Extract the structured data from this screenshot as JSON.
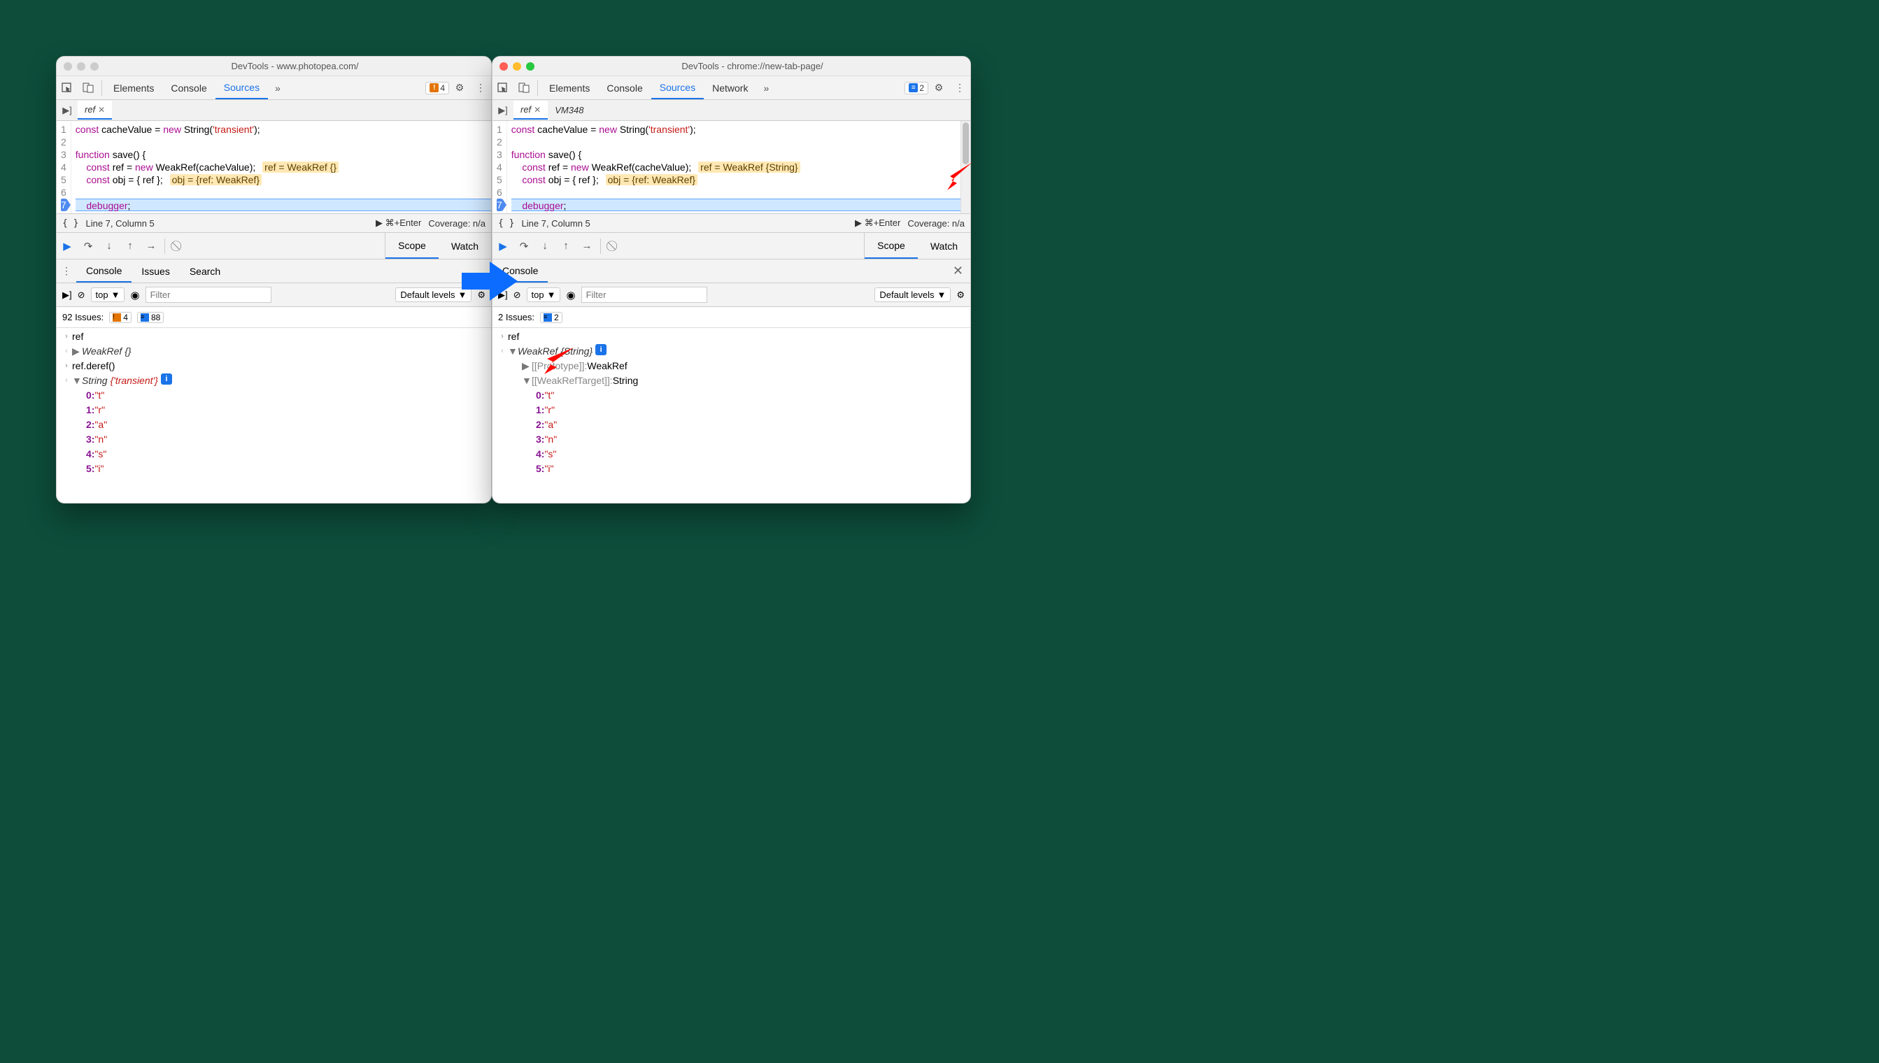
{
  "left": {
    "title": "DevTools - www.photopea.com/",
    "toolbar": {
      "tabs": [
        "Elements",
        "Console",
        "Sources"
      ],
      "active": "Sources",
      "badge_count": "4"
    },
    "file_tabs": {
      "active": "ref",
      "others": []
    },
    "code": {
      "lines": [
        {
          "n": "1",
          "pre": "const cacheValue = ",
          "kw": "new",
          "post": " String(",
          "str": "'transient'",
          "tail": ");"
        },
        {
          "n": "2",
          "pre": ""
        },
        {
          "n": "3",
          "pre": "function save() {"
        },
        {
          "n": "4",
          "pre": "    const ref = ",
          "kw": "new",
          "post": " WeakRef(cacheValue); ",
          "val": "ref = WeakRef {}"
        },
        {
          "n": "5",
          "pre": "    const obj = { ref }; ",
          "val": "obj = {ref: WeakRef}"
        },
        {
          "n": "6",
          "pre": ""
        },
        {
          "n": "7",
          "pre": "    ",
          "dbg": "debugger",
          "tail": ";",
          "exec": true
        }
      ]
    },
    "status": {
      "pos": "Line 7, Column 5",
      "run": "▶ ⌘+Enter",
      "cov": "Coverage: n/a"
    },
    "dbg_tabs": {
      "scope": "Scope",
      "watch": "Watch"
    },
    "drawer": {
      "tabs": [
        "Console",
        "Issues",
        "Search"
      ],
      "active": "Console"
    },
    "filter": {
      "context": "top",
      "levels": "Default levels",
      "placeholder": "Filter"
    },
    "issues": {
      "label": "92 Issues:",
      "warn": "4",
      "info": "88"
    },
    "console": {
      "entries": [
        {
          "t": "in",
          "text": "ref"
        },
        {
          "t": "out",
          "toggle": "▶",
          "obj": "WeakRef {}"
        },
        {
          "t": "in",
          "text": "ref.deref()"
        },
        {
          "t": "out",
          "toggle": "▼",
          "obj": "String ",
          "objstr": "{'transient'}",
          "info": true,
          "children": [
            {
              "k": "0",
              "v": "\"t\""
            },
            {
              "k": "1",
              "v": "\"r\""
            },
            {
              "k": "2",
              "v": "\"a\""
            },
            {
              "k": "3",
              "v": "\"n\""
            },
            {
              "k": "4",
              "v": "\"s\""
            },
            {
              "k": "5",
              "v": "\"i\""
            }
          ]
        }
      ]
    }
  },
  "right": {
    "title": "DevTools - chrome://new-tab-page/",
    "toolbar": {
      "tabs": [
        "Elements",
        "Console",
        "Sources",
        "Network"
      ],
      "active": "Sources",
      "badge_count": "2"
    },
    "file_tabs": {
      "active": "ref",
      "others": [
        "VM348"
      ]
    },
    "code": {
      "lines": [
        {
          "n": "1",
          "pre": "const cacheValue = ",
          "kw": "new",
          "post": " String(",
          "str": "'transient'",
          "tail": ");"
        },
        {
          "n": "2",
          "pre": ""
        },
        {
          "n": "3",
          "pre": "function save() {"
        },
        {
          "n": "4",
          "pre": "    const ref = ",
          "kw": "new",
          "post": " WeakRef(cacheValue); ",
          "val": "ref = WeakRef {String}"
        },
        {
          "n": "5",
          "pre": "    const obj = { ref }; ",
          "val": "obj = {ref: WeakRef}"
        },
        {
          "n": "6",
          "pre": ""
        },
        {
          "n": "7",
          "pre": "    ",
          "dbg": "debugger",
          "tail": ";",
          "exec": true
        }
      ]
    },
    "status": {
      "pos": "Line 7, Column 5",
      "run": "▶ ⌘+Enter",
      "cov": "Coverage: n/a"
    },
    "dbg_tabs": {
      "scope": "Scope",
      "watch": "Watch"
    },
    "drawer": {
      "tabs": [
        "Console"
      ],
      "active": "Console"
    },
    "filter": {
      "context": "top",
      "levels": "Default levels",
      "placeholder": "Filter"
    },
    "issues": {
      "label": "2 Issues:",
      "info": "2"
    },
    "console": {
      "entries": [
        {
          "t": "in",
          "text": "ref"
        },
        {
          "t": "out",
          "toggle": "▼",
          "obj": "WeakRef {String}",
          "info": true,
          "children": [
            {
              "toggle": "▶",
              "internal": "[[Prototype]]:",
              "v": "WeakRef"
            },
            {
              "toggle": "▼",
              "internal": "[[WeakRefTarget]]:",
              "v": "String",
              "children": [
                {
                  "k": "0",
                  "v": "\"t\""
                },
                {
                  "k": "1",
                  "v": "\"r\""
                },
                {
                  "k": "2",
                  "v": "\"a\""
                },
                {
                  "k": "3",
                  "v": "\"n\""
                },
                {
                  "k": "4",
                  "v": "\"s\""
                },
                {
                  "k": "5",
                  "v": "\"i\""
                }
              ]
            }
          ]
        }
      ]
    }
  }
}
